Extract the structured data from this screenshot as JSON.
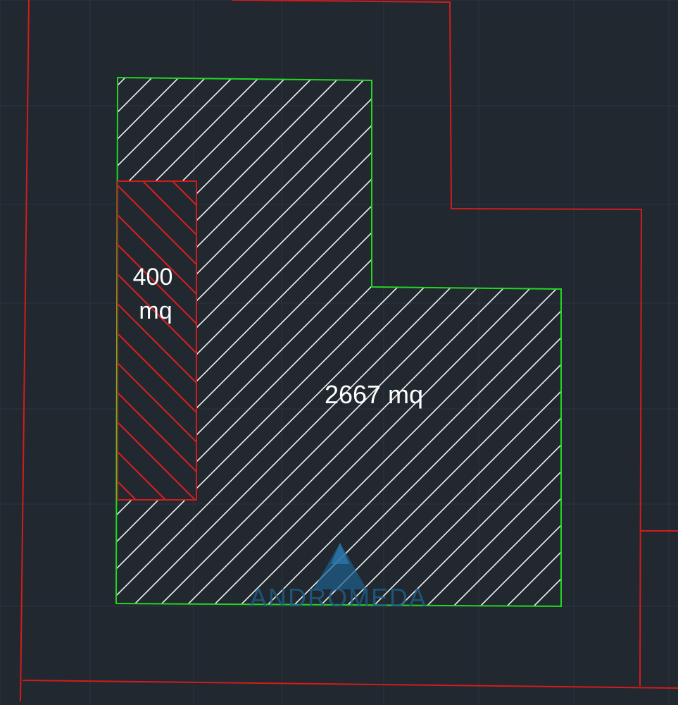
{
  "plan": {
    "colors": {
      "background": "#212830",
      "grid": "#2d3540",
      "property_line": "#d21c1c",
      "building_outline": "#22d722",
      "hatch_main": "#f2f2f2",
      "hatch_small": "#e01f1f",
      "watermark": "#1e5f8c"
    },
    "areas": {
      "main": {
        "value": 2667,
        "label": "2667 mq"
      },
      "small": {
        "value": 400,
        "label_line1": "400",
        "label_line2": "mq"
      }
    },
    "watermark": {
      "text": "ANDROMEDA",
      "icon": "mountain-peak-icon"
    }
  }
}
